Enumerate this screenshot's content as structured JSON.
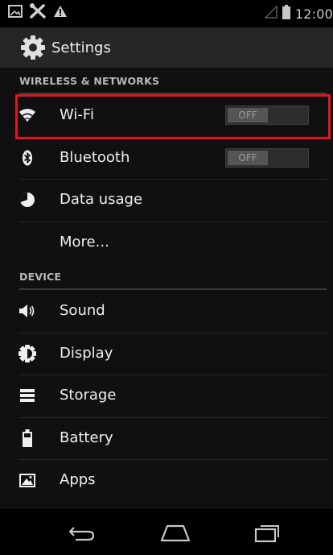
{
  "status_bar": {
    "time": "12:00",
    "left_icons": [
      "gallery-icon",
      "tools-icon",
      "warning-icon"
    ],
    "right_icons": [
      "signal-icon",
      "battery-icon"
    ]
  },
  "action_bar": {
    "title": "Settings",
    "icon": "settings-gear-icon"
  },
  "sections": [
    {
      "header": "WIRELESS & NETWORKS",
      "items": [
        {
          "label": "Wi-Fi",
          "icon": "wifi-icon",
          "toggle": "OFF",
          "highlighted": true
        },
        {
          "label": "Bluetooth",
          "icon": "bluetooth-icon",
          "toggle": "OFF"
        },
        {
          "label": "Data usage",
          "icon": "data-usage-icon"
        },
        {
          "label": "More...",
          "icon": ""
        }
      ]
    },
    {
      "header": "DEVICE",
      "items": [
        {
          "label": "Sound",
          "icon": "sound-icon"
        },
        {
          "label": "Display",
          "icon": "display-icon"
        },
        {
          "label": "Storage",
          "icon": "storage-icon"
        },
        {
          "label": "Battery",
          "icon": "battery-icon"
        },
        {
          "label": "Apps",
          "icon": "apps-icon"
        }
      ]
    }
  ],
  "nav_bar": {
    "buttons": [
      "back-icon",
      "home-icon",
      "recent-apps-icon"
    ]
  },
  "colors": {
    "highlight": "#e8121e",
    "action_bar": "#262626",
    "list_background": "#101010"
  }
}
